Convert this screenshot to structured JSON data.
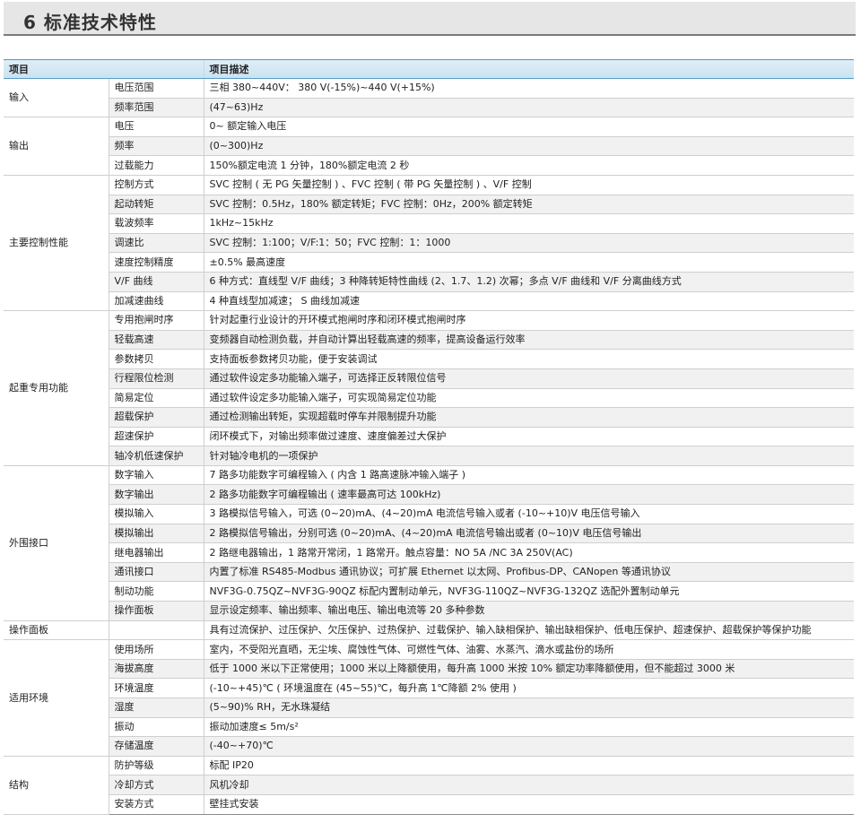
{
  "page": {
    "title": "6 标准技术特性"
  },
  "table": {
    "header": {
      "col1": "项目",
      "col2": "项目描述"
    },
    "groups": [
      {
        "name": "输入",
        "rows": [
          {
            "item": "电压范围",
            "desc": "三相 380~440V： 380 V(-15%)~440 V(+15%)"
          },
          {
            "item": "频率范围",
            "desc": "(47~63)Hz"
          }
        ]
      },
      {
        "name": "输出",
        "rows": [
          {
            "item": "电压",
            "desc": "0~ 额定输入电压"
          },
          {
            "item": "频率",
            "desc": "(0~300)Hz"
          },
          {
            "item": "过载能力",
            "desc": "150%额定电流 1 分钟，180%额定电流 2 秒"
          }
        ]
      },
      {
        "name": "主要控制性能",
        "rows": [
          {
            "item": "控制方式",
            "desc": "SVC 控制 ( 无 PG 矢量控制 ) 、FVC 控制 ( 带 PG 矢量控制 ) 、V/F 控制"
          },
          {
            "item": "起动转矩",
            "desc": "SVC 控制：0.5Hz，180% 额定转矩；FVC 控制：0Hz，200% 额定转矩"
          },
          {
            "item": "载波频率",
            "desc": "1kHz~15kHz"
          },
          {
            "item": "调速比",
            "desc": "SVC 控制：1:100；V/F:1：50；FVC 控制：1：1000"
          },
          {
            "item": "速度控制精度",
            "desc": "±0.5% 最高速度"
          },
          {
            "item": "V/F 曲线",
            "desc": "6 种方式：直线型 V/F 曲线；3 种降转矩特性曲线 (2、1.7、1.2) 次幂；多点 V/F 曲线和 V/F 分离曲线方式"
          },
          {
            "item": "加减速曲线",
            "desc": "4 种直线型加减速； S 曲线加减速"
          }
        ]
      },
      {
        "name": "起重专用功能",
        "rows": [
          {
            "item": "专用抱闸时序",
            "desc": "针对起重行业设计的开环模式抱闸时序和闭环模式抱闸时序"
          },
          {
            "item": "轻载高速",
            "desc": "变频器自动检测负载，并自动计算出轻载高速的频率，提高设备运行效率"
          },
          {
            "item": "参数拷贝",
            "desc": "支持面板参数拷贝功能，便于安装调试"
          },
          {
            "item": "行程限位检测",
            "desc": "通过软件设定多功能输入端子，可选择正反转限位信号"
          },
          {
            "item": "简易定位",
            "desc": "通过软件设定多功能输入端子，可实现简易定位功能"
          },
          {
            "item": "超载保护",
            "desc": "通过检测输出转矩，实现超载时停车并限制提升功能"
          },
          {
            "item": "超速保护",
            "desc": "闭环模式下，对输出频率做过速度、速度偏差过大保护"
          },
          {
            "item": "轴冷机低速保护",
            "desc": "针对轴冷电机的一项保护"
          }
        ]
      },
      {
        "name": "外围接口",
        "rows": [
          {
            "item": "数字输入",
            "desc": "7 路多功能数字可编程输入 ( 内含 1 路高速脉冲输入端子 )"
          },
          {
            "item": "数字输出",
            "desc": "2 路多功能数字可编程输出 ( 速率最高可达 100kHz)"
          },
          {
            "item": "模拟输入",
            "desc": "3 路模拟信号输入，可选 (0~20)mA、(4~20)mA 电流信号输入或者 (-10~+10)V 电压信号输入"
          },
          {
            "item": "模拟输出",
            "desc": "2 路模拟信号输出，分别可选 (0~20)mA、(4~20)mA 电流信号输出或者 (0~10)V 电压信号输出"
          },
          {
            "item": "继电器输出",
            "desc": "2 路继电器输出，1 路常开常闭，1 路常开。触点容量：NO 5A /NC 3A  250V(AC)"
          },
          {
            "item": "通讯接口",
            "desc": "内置了标准 RS485-Modbus 通讯协议；可扩展 Ethernet 以太网、Profibus-DP、CANopen 等通讯协议"
          },
          {
            "item": "制动功能",
            "desc": "NVF3G-0.75QZ~NVF3G-90QZ 标配内置制动单元，NVF3G-110QZ~NVF3G-132QZ 选配外置制动单元"
          },
          {
            "item": "操作面板",
            "desc": "显示设定频率、输出频率、输出电压、输出电流等 20 多种参数"
          }
        ]
      },
      {
        "name": "操作面板",
        "rows": [
          {
            "item": "",
            "desc": "具有过流保护、过压保护、欠压保护、过热保护、过载保护、输入缺相保护、输出缺相保护、低电压保护、超速保护、超载保护等保护功能"
          }
        ]
      },
      {
        "name": "适用环境",
        "rows": [
          {
            "item": "使用场所",
            "desc": "室内，不受阳光直晒，无尘埃、腐蚀性气体、可燃性气体、油雾、水蒸汽、滴水或盐份的场所"
          },
          {
            "item": "海拔高度",
            "desc": "低于 1000 米以下正常使用；1000 米以上降额使用，每升高 1000 米按 10% 额定功率降额使用，但不能超过 3000 米"
          },
          {
            "item": "环境温度",
            "desc": "(-10~+45)℃ ( 环境温度在 (45~55)℃，每升高 1℃降额 2% 使用 )"
          },
          {
            "item": "湿度",
            "desc": "(5~90)% RH，无水珠凝结"
          },
          {
            "item": "振动",
            "desc": "振动加速度≤ 5m/s²"
          },
          {
            "item": "存储温度",
            "desc": "(-40~+70)℃"
          }
        ]
      },
      {
        "name": "结构",
        "rows": [
          {
            "item": "防护等级",
            "desc": "标配 IP20"
          },
          {
            "item": "冷却方式",
            "desc": "风机冷却"
          },
          {
            "item": "安装方式",
            "desc": "壁挂式安装"
          }
        ]
      }
    ]
  }
}
